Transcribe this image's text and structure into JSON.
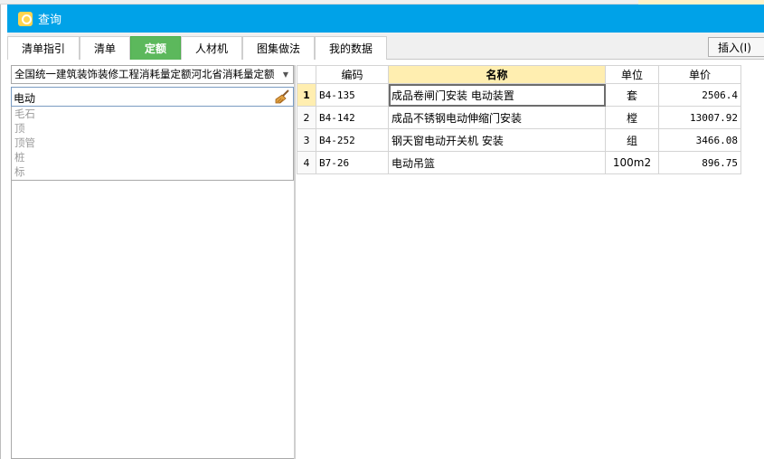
{
  "window": {
    "title": "查询"
  },
  "tabs": [
    {
      "label": "清单指引"
    },
    {
      "label": "清单"
    },
    {
      "label": "定额",
      "active": true
    },
    {
      "label": "人材机"
    },
    {
      "label": "图集做法"
    },
    {
      "label": "我的数据"
    }
  ],
  "toolbar": {
    "insert_label": "插入(I)"
  },
  "left": {
    "library_selected": "全国统一建筑装饰装修工程消耗量定额河北省消耗量定额",
    "search_value": "电动",
    "history": [
      "毛石",
      "顶",
      "顶管",
      "桩",
      "标"
    ]
  },
  "grid": {
    "headers": {
      "index": "",
      "code": "编码",
      "name": "名称",
      "unit": "单位",
      "price": "单价"
    },
    "rows": [
      {
        "index": "1",
        "code": "B4-135",
        "name": "成品卷闸门安装 电动装置",
        "unit": "套",
        "price": "2506.4"
      },
      {
        "index": "2",
        "code": "B4-142",
        "name": "成品不锈钢电动伸缩门安装",
        "unit": "樘",
        "price": "13007.92"
      },
      {
        "index": "3",
        "code": "B4-252",
        "name": "钢天窗电动开关机 安装",
        "unit": "组",
        "price": "3466.08"
      },
      {
        "index": "4",
        "code": "B7-26",
        "name": "电动吊篮",
        "unit": "100m2",
        "price": "896.75"
      }
    ]
  },
  "colors": {
    "titlebar": "#00a2e8",
    "active_tab": "#5cb85c",
    "highlight": "#ffeeb0"
  }
}
